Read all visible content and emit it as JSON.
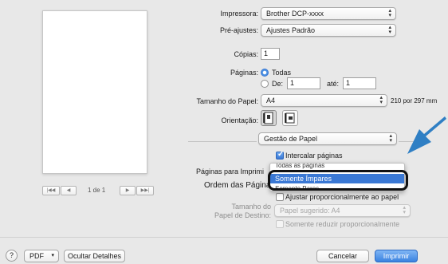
{
  "preview": {
    "page_counter": "1 de 1",
    "first_label": "|◀◀",
    "prev_label": "◀",
    "next_label": "▶",
    "last_label": "▶▶|"
  },
  "form": {
    "printer_label": "Impressora:",
    "printer_value": "Brother DCP-xxxx",
    "presets_label": "Pré-ajustes:",
    "presets_value": "Ajustes Padrão",
    "copies_label": "Cópias:",
    "copies_value": "1",
    "pages_label": "Páginas:",
    "pages_all": "Todas",
    "pages_from": "De:",
    "pages_from_value": "1",
    "pages_to": "até:",
    "pages_to_value": "1",
    "paper_size_label": "Tamanho do Papel:",
    "paper_size_value": "A4",
    "paper_size_dims": "210 por 297 mm",
    "orientation_label": "Orientação:"
  },
  "section": {
    "value": "Gestão de Papel",
    "collate_label": "Intercalar páginas",
    "collate_checked": true,
    "pages_to_print_label": "Páginas para Imprimi",
    "page_order_label": "Ordem das Página",
    "scale_label": "Ajustar proporcionalmente ao papel",
    "dest_paper_label_1": "Tamanho do",
    "dest_paper_label_2": "Papel de Destino:",
    "dest_paper_value": "Papel sugerido: A4",
    "reduce_only_label": "Somente reduzir proporcionalmente"
  },
  "dropdown": {
    "items": [
      "Todas as páginas",
      "Somente Ímpares",
      "Somente Pares"
    ],
    "selected_index": 1
  },
  "footer": {
    "help_label": "?",
    "pdf_label": "PDF",
    "hide_details_label": "Ocultar Detalhes",
    "cancel_label": "Cancelar",
    "print_label": "Imprimir"
  },
  "colors": {
    "accent": "#3a78d4",
    "arrow": "#2f7fc4",
    "highlight_ring": "#111111"
  }
}
